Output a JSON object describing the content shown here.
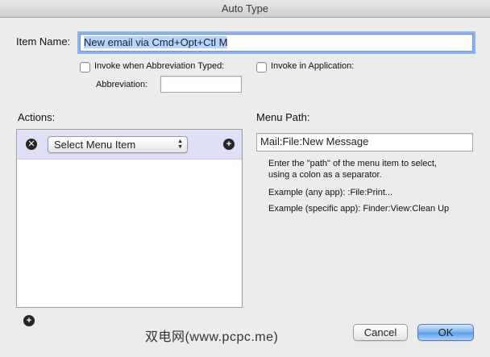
{
  "window": {
    "title": "Auto Type"
  },
  "item_name": {
    "label": "Item Name:",
    "value": "New email via Cmd+Opt+Ctl M"
  },
  "invoke_abbreviation": {
    "label": "Invoke when Abbreviation Typed:",
    "checked": false
  },
  "invoke_application": {
    "label": "Invoke in Application:",
    "checked": false
  },
  "abbreviation": {
    "label": "Abbreviation:",
    "value": ""
  },
  "actions": {
    "label": "Actions:",
    "rows": [
      {
        "action": "Select Menu Item",
        "remove_icon": "remove-icon",
        "add_icon": "add-icon"
      }
    ],
    "add_icon": "add-icon"
  },
  "menu_path": {
    "label": "Menu Path:",
    "value": "Mail:File:New Message",
    "help_line1": "Enter the \"path\" of the menu item to select,",
    "help_line2": "using a colon as a separator.",
    "example_any": "Example (any app):  :File:Print...",
    "example_specific": "Example (specific app):  Finder:View:Clean Up"
  },
  "buttons": {
    "cancel": "Cancel",
    "ok": "OK"
  },
  "watermark": "双电网(www.pcpc.me)"
}
